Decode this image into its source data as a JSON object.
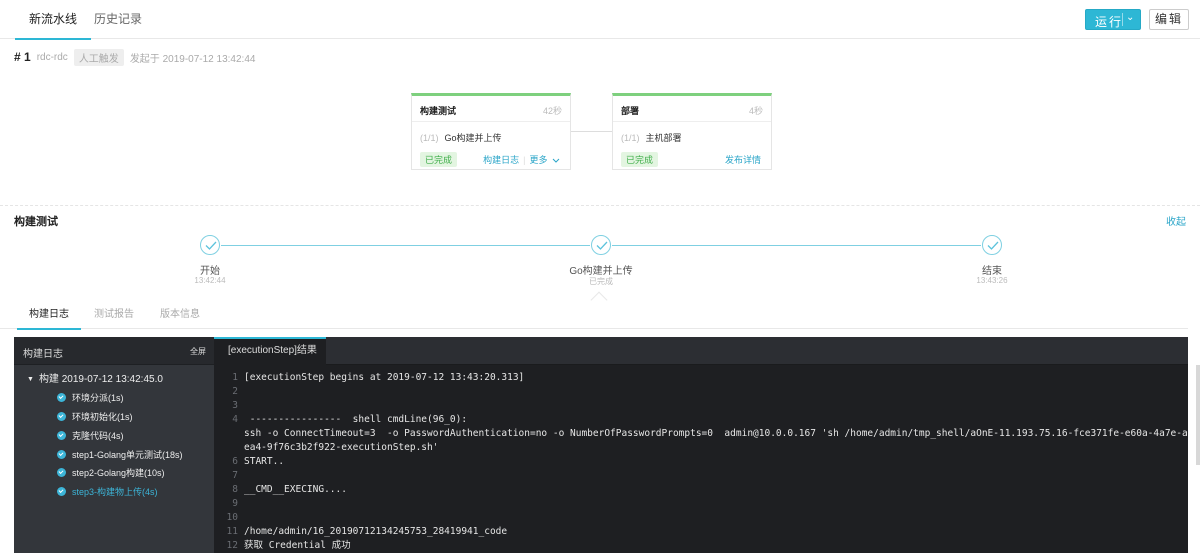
{
  "header": {
    "tabs": [
      {
        "label": "新流水线",
        "active": true
      },
      {
        "label": "历史记录",
        "active": false
      }
    ],
    "run_label": "运行",
    "edit_label": "编辑"
  },
  "build": {
    "number": "# 1",
    "user": "rdc-rdc",
    "trigger": "人工触发",
    "started": "发起于 2019-07-12 13:42:44"
  },
  "stages": [
    {
      "title": "构建测试",
      "duration": "42秒",
      "job_count": "(1/1)",
      "job_name": "Go构建并上传",
      "status": "已完成",
      "link1": "构建日志",
      "link2": "更多"
    },
    {
      "title": "部署",
      "duration": "4秒",
      "job_count": "(1/1)",
      "job_name": "主机部署",
      "status": "已完成",
      "link1": "发布详情"
    }
  ],
  "progress": {
    "title": "构建测试",
    "collapse": "收起",
    "steps": [
      {
        "name": "开始",
        "sub": "13:42:44"
      },
      {
        "name": "Go构建并上传",
        "sub": "已完成"
      },
      {
        "name": "结束",
        "sub": "13:43:26"
      }
    ]
  },
  "bottom_tabs": [
    "构建日志",
    "测试报告",
    "版本信息"
  ],
  "log": {
    "side_title": "构建日志",
    "fullscreen": "全屏",
    "root": "构建 2019-07-12 13:42:45.0",
    "items": [
      {
        "label": "环境分派(1s)"
      },
      {
        "label": "环境初始化(1s)"
      },
      {
        "label": "克隆代码(4s)"
      },
      {
        "label": "step1-Golang单元测试(18s)"
      },
      {
        "label": "step2-Golang构建(10s)"
      },
      {
        "label": "step3-构建物上传(4s)",
        "active": true
      }
    ],
    "tab": "[executionStep]结果",
    "lines": [
      {
        "n": "1",
        "t": "[executionStep begins at 2019-07-12 13:43:20.313]"
      },
      {
        "n": "2",
        "t": ""
      },
      {
        "n": "3",
        "t": ""
      },
      {
        "n": "4",
        "t": " ----------------  shell cmdLine(96_0):"
      },
      {
        "n": "",
        "t": "ssh -o ConnectTimeout=3  -o PasswordAuthentication=no -o NumberOfPasswordPrompts=0  admin@10.0.0.167 'sh /home/admin/tmp_shell/aOnE-11.193.75.16-fce371fe-e60a-4a7e-a"
      },
      {
        "n": "",
        "t": "ea4-9f76c3b2f922-executionStep.sh'"
      },
      {
        "n": "6",
        "t": "START.."
      },
      {
        "n": "7",
        "t": ""
      },
      {
        "n": "8",
        "t": "__CMD__EXECING...."
      },
      {
        "n": "9",
        "t": ""
      },
      {
        "n": "10",
        "t": ""
      },
      {
        "n": "11",
        "t": "/home/admin/16_20190712134245753_28419941_code"
      },
      {
        "n": "12",
        "t": "获取 Credential 成功"
      }
    ]
  },
  "colors": {
    "accent": "#2db7d5",
    "success": "#3fae49",
    "log_bg": "#1e1f22"
  }
}
